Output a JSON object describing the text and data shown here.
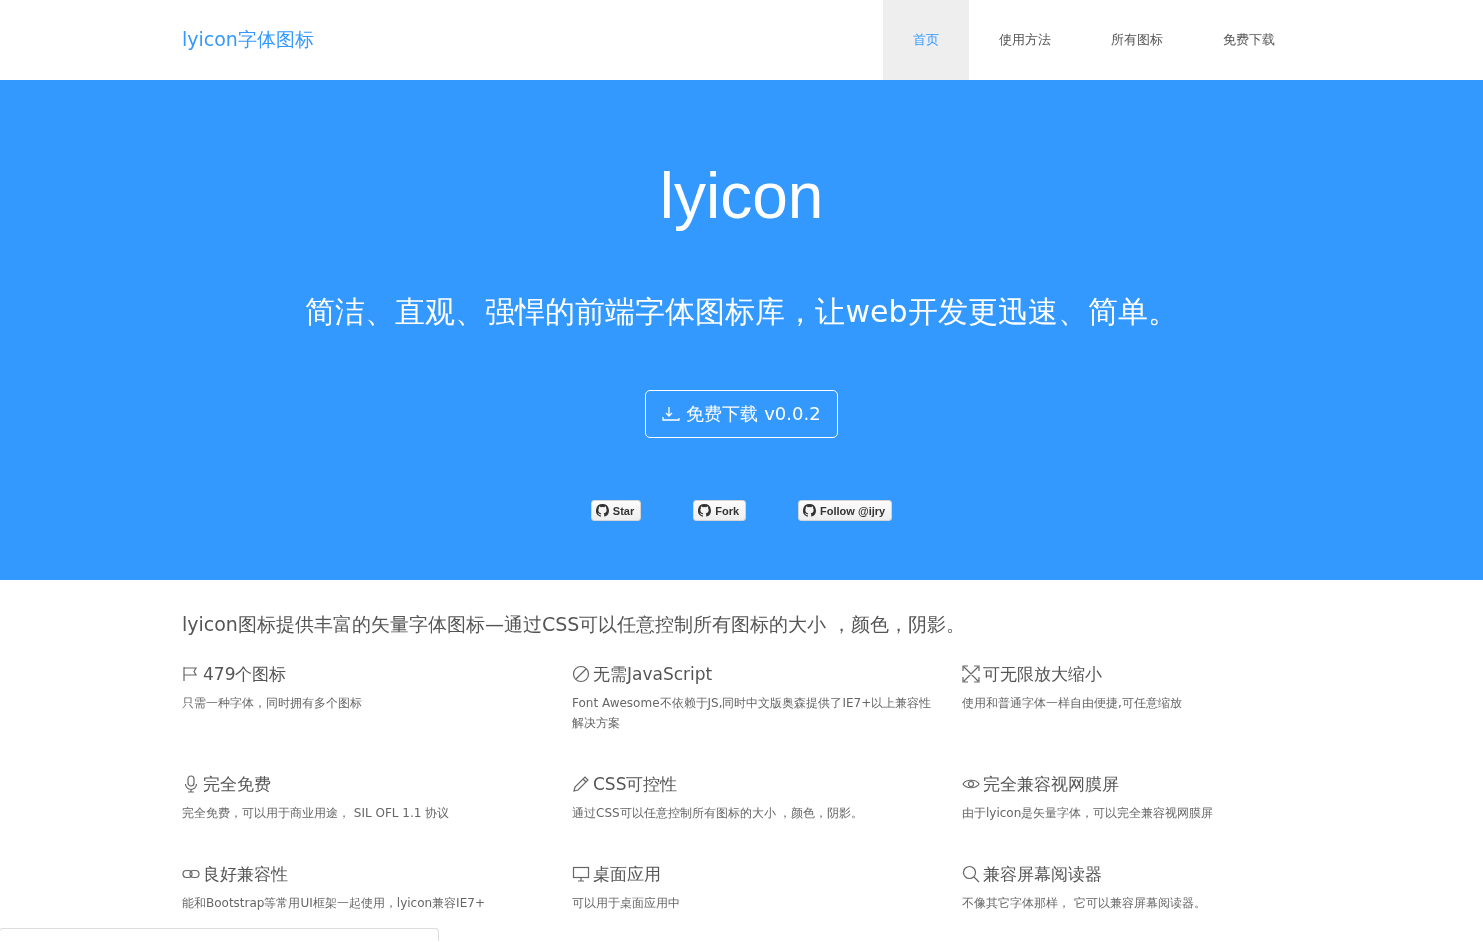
{
  "brand": "lyicon字体图标",
  "nav": [
    {
      "label": "首页",
      "selected": true
    },
    {
      "label": "使用方法",
      "selected": false
    },
    {
      "label": "所有图标",
      "selected": false
    },
    {
      "label": "免费下载",
      "selected": false
    }
  ],
  "hero": {
    "title": "lyicon",
    "subtitle": "简洁、直观、强悍的前端字体图标库，让web开发更迅速、简单。",
    "download": "免费下载 v0.0.2",
    "github": [
      "Star",
      "Fork",
      "Follow @ijry"
    ]
  },
  "intro": "lyicon图标提供丰富的矢量字体图标—通过CSS可以任意控制所有图标的大小 ，颜色，阴影。",
  "features": [
    {
      "kind": "flag",
      "title": "479个图标",
      "text": "只需一种字体，同时拥有多个图标"
    },
    {
      "kind": "forbid",
      "title": "无需JavaScript",
      "text": "Font Awesome不依赖于JS,同时中文版奥森提供了IE7+以上兼容性解决方案"
    },
    {
      "kind": "expand",
      "title": "可无限放大缩小",
      "text": "使用和普通字体一样自由便捷,可任意缩放"
    },
    {
      "kind": "mic",
      "title": "完全免费",
      "text": "完全免费，可以用于商业用途， SIL OFL 1.1 协议"
    },
    {
      "kind": "pencil",
      "title": "CSS可控性",
      "text": "通过CSS可以任意控制所有图标的大小 ，颜色，阴影。"
    },
    {
      "kind": "eye",
      "title": "完全兼容视网膜屏",
      "text": "由于lyicon是矢量字体，可以完全兼容视网膜屏"
    },
    {
      "kind": "link",
      "title": "良好兼容性",
      "text": "能和Bootstrap等常用UI框架一起使用，lyicon兼容IE7+"
    },
    {
      "kind": "monitor",
      "title": "桌面应用",
      "text": "可以用于桌面应用中"
    },
    {
      "kind": "search",
      "title": "兼容屏幕阅读器",
      "text": "不像其它字体那样， 它可以兼容屏幕阅读器。"
    }
  ]
}
